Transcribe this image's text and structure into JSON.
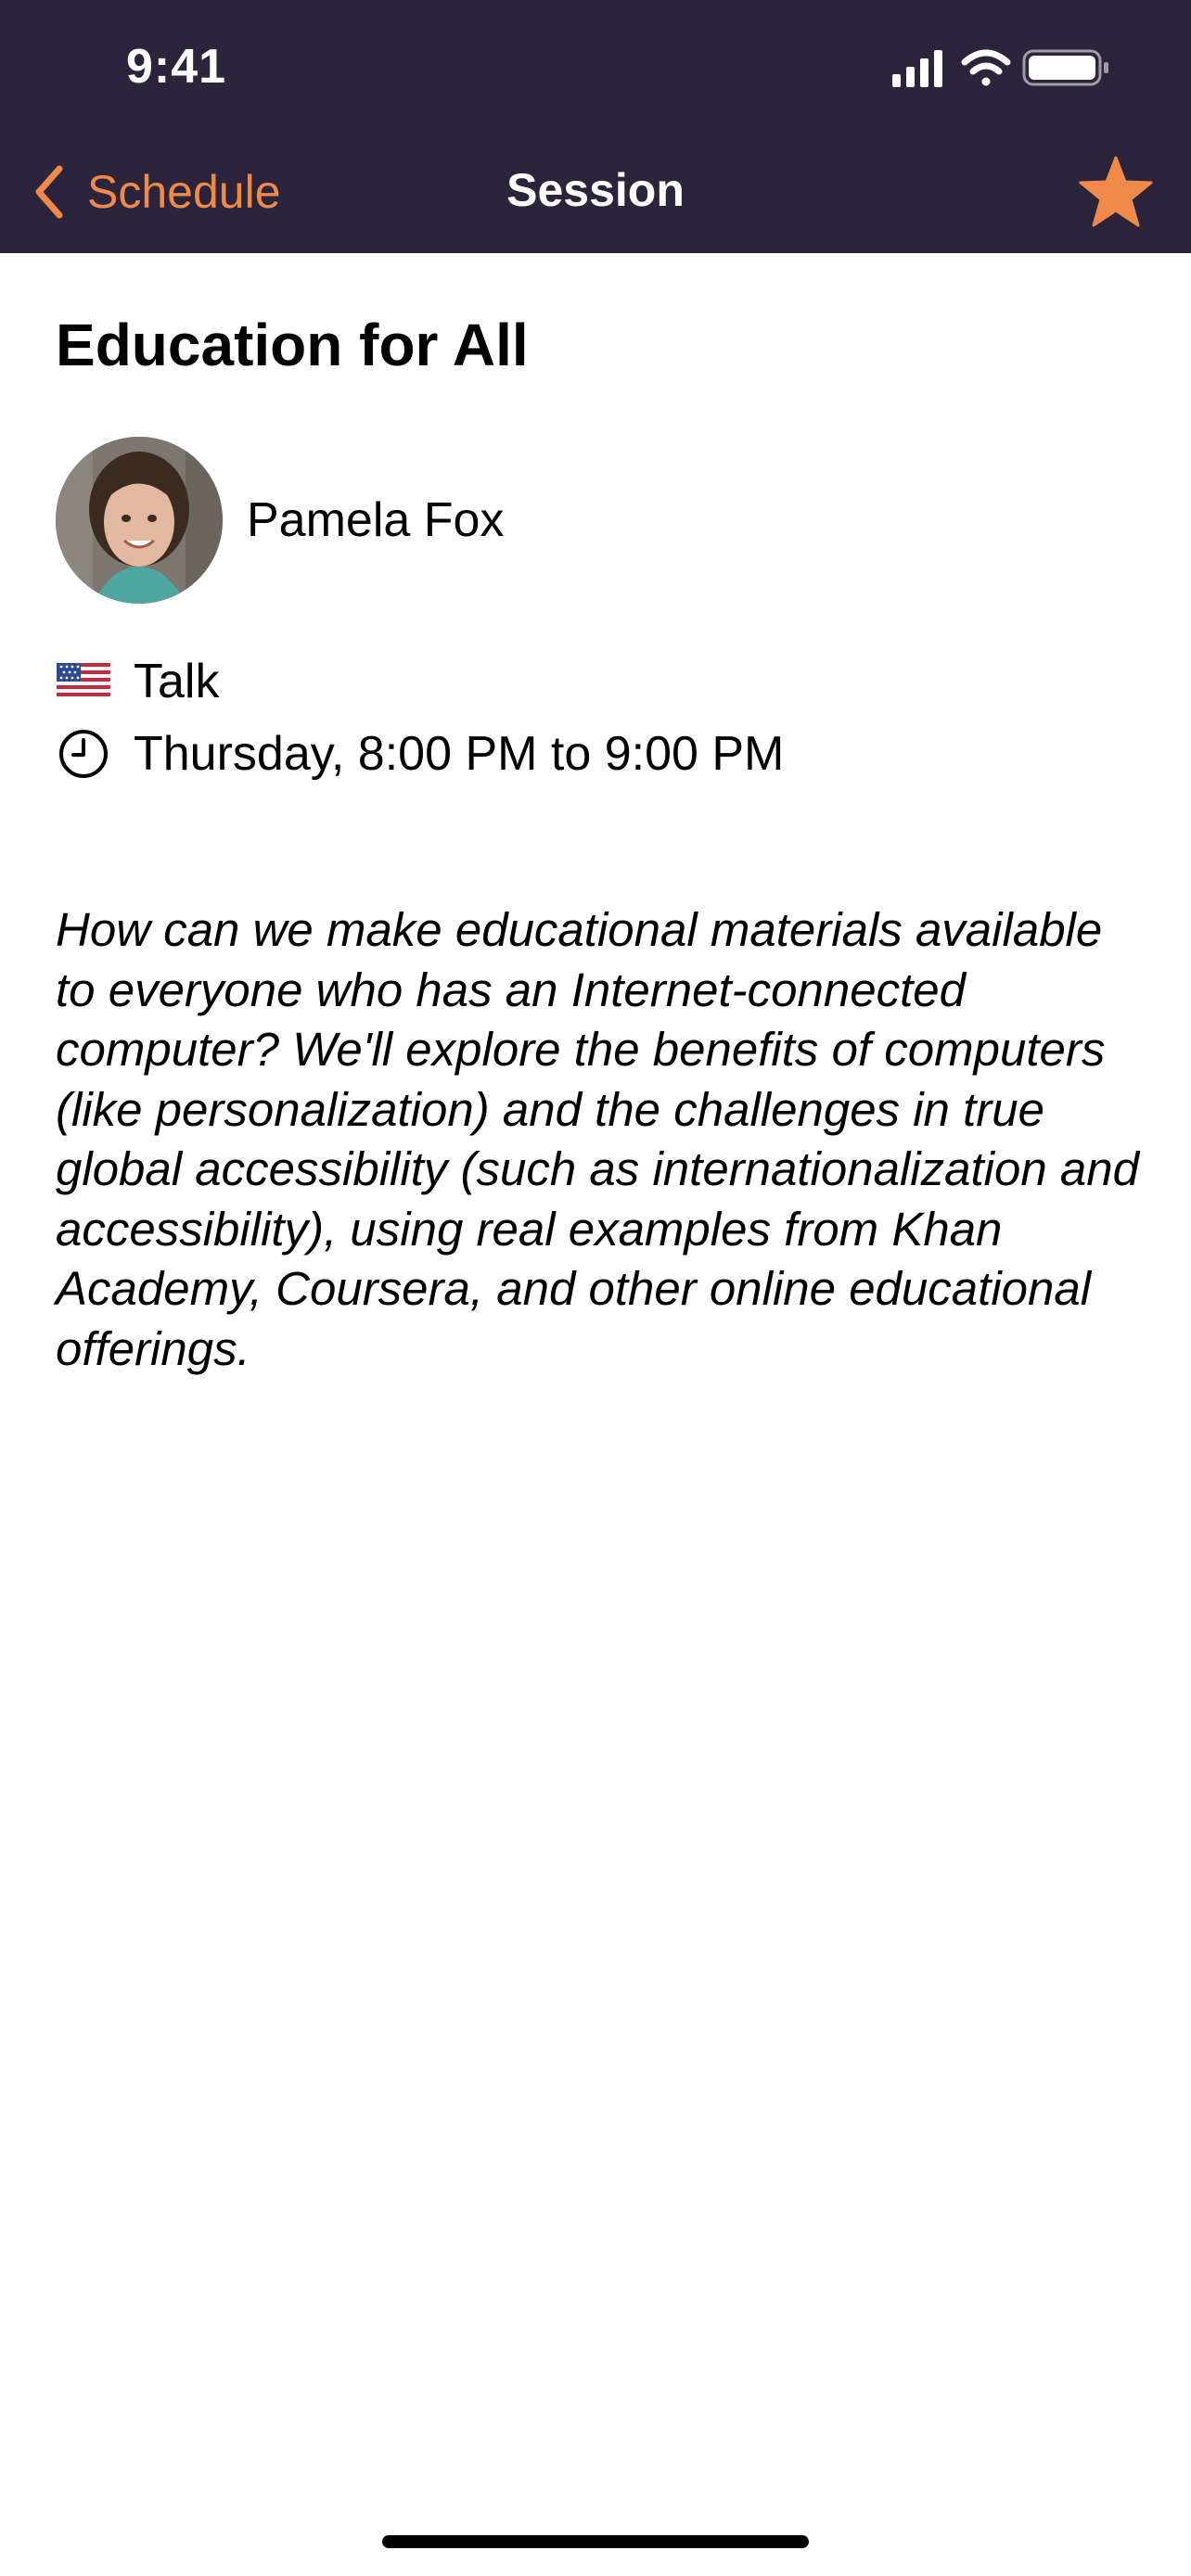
{
  "status_bar": {
    "time": "9:41"
  },
  "nav": {
    "back_label": "Schedule",
    "title": "Session",
    "favorite_icon": "star-icon"
  },
  "colors": {
    "accent": "#f08a4b",
    "header_bg": "#2b243b",
    "text": "#000000"
  },
  "session": {
    "title": "Education for All",
    "speaker": {
      "name": "Pamela Fox"
    },
    "track_icon": "us-flag-icon",
    "track": "Talk",
    "time_icon": "clock-icon",
    "time": "Thursday, 8:00 PM to 9:00 PM",
    "description": "How can we make educational materials available to everyone who has an Internet-connected computer? We'll explore the benefits of computers (like personalization) and the challenges in true global accessibility (such as internationalization and accessibility), using real examples from Khan Academy, Coursera, and other online educational offerings."
  }
}
